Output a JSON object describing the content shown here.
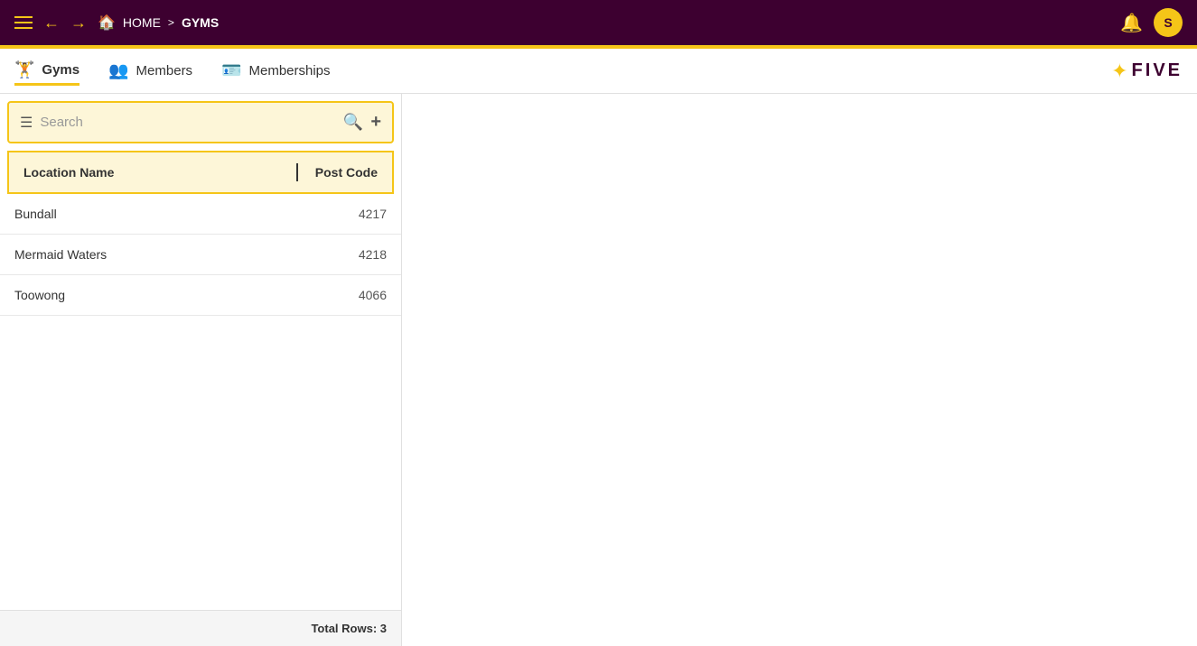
{
  "topbar": {
    "home_label": "HOME",
    "current_page": "GYMS",
    "user_initial": "S"
  },
  "subnav": {
    "items": [
      {
        "label": "Gyms",
        "icon": "🏋",
        "active": true
      },
      {
        "label": "Members",
        "icon": "👥",
        "active": false
      },
      {
        "label": "Memberships",
        "icon": "🪪",
        "active": false
      }
    ]
  },
  "logo": {
    "text": "FIVE"
  },
  "search": {
    "placeholder": "Search"
  },
  "table": {
    "headers": {
      "location": "Location Name",
      "postcode": "Post Code"
    },
    "rows": [
      {
        "location": "Bundall",
        "postcode": "4217"
      },
      {
        "location": "Mermaid Waters",
        "postcode": "4218"
      },
      {
        "location": "Toowong",
        "postcode": "4066"
      }
    ],
    "footer": "Total Rows: 3"
  }
}
